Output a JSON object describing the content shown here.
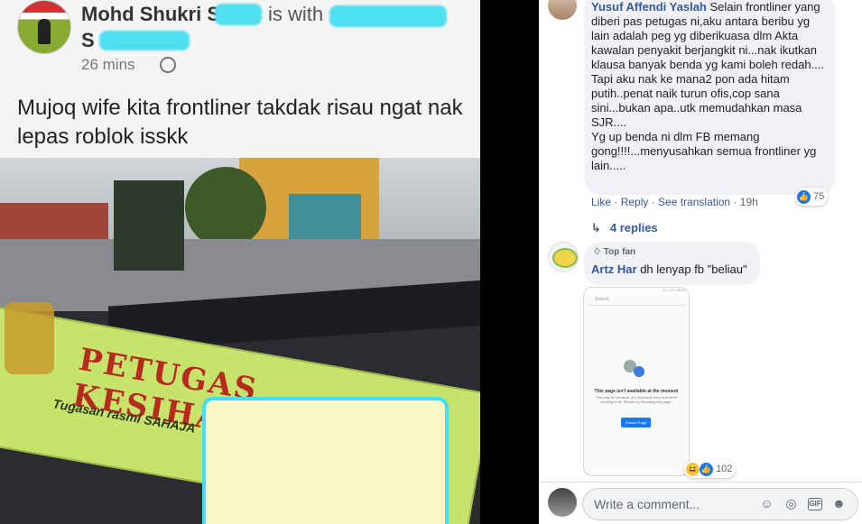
{
  "post": {
    "author": "Mohd Shukri S",
    "with_text": "is with",
    "second_line": "S",
    "time": "26 mins",
    "caption": "Mujoq wife kita frontliner takdak risau ngat nak lepas roblok isskk",
    "photo": {
      "sign_text": "PETUGAS KESIHATAN",
      "sign_subtext": "Tugasan rasmi SAHAJA"
    }
  },
  "comments": [
    {
      "name": "Yusuf Affendi Yaslah",
      "text": "Selain frontliner yang diberi pas petugas ni,aku antara beribu yg lain adalah peg yg diberikuasa dlm Akta kawalan penyakit berjangkit ni...nak ikutkan klausa banyak benda yg kami boleh redah....\nTapi aku nak ke mana2 pon ada hitam putih..penat naik turun ofis,cop sana sini...bukan apa..utk memudahkan masa SJR....\nYg up benda ni dlm FB memang gong!!!!...menyusahkan semua frontliner yg lain.....",
      "actions": [
        "Like",
        "Reply",
        "See translation"
      ],
      "time": "19h",
      "reaction_count": "75",
      "replies": "4 replies"
    },
    {
      "badge": "Top fan",
      "name": "Artz Har",
      "text": "dh lenyap fb \"beliau\"",
      "reaction_count": "102",
      "screenshot": {
        "status": "4G LTE 100%",
        "search": "Search",
        "title": "This page isn't available at the moment",
        "body": "This may be because of a technical error that we're working to fix. Please try reloading this page.",
        "button": "Reload Page"
      }
    }
  ],
  "composer": {
    "placeholder": "Write a comment...",
    "icons": [
      "emoji-icon",
      "camera-icon",
      "gif-icon",
      "sticker-icon"
    ],
    "gif_label": "GIF"
  },
  "colors": {
    "link": "#385898",
    "like": "#1877f2",
    "bubble": "#f0f2f5"
  }
}
